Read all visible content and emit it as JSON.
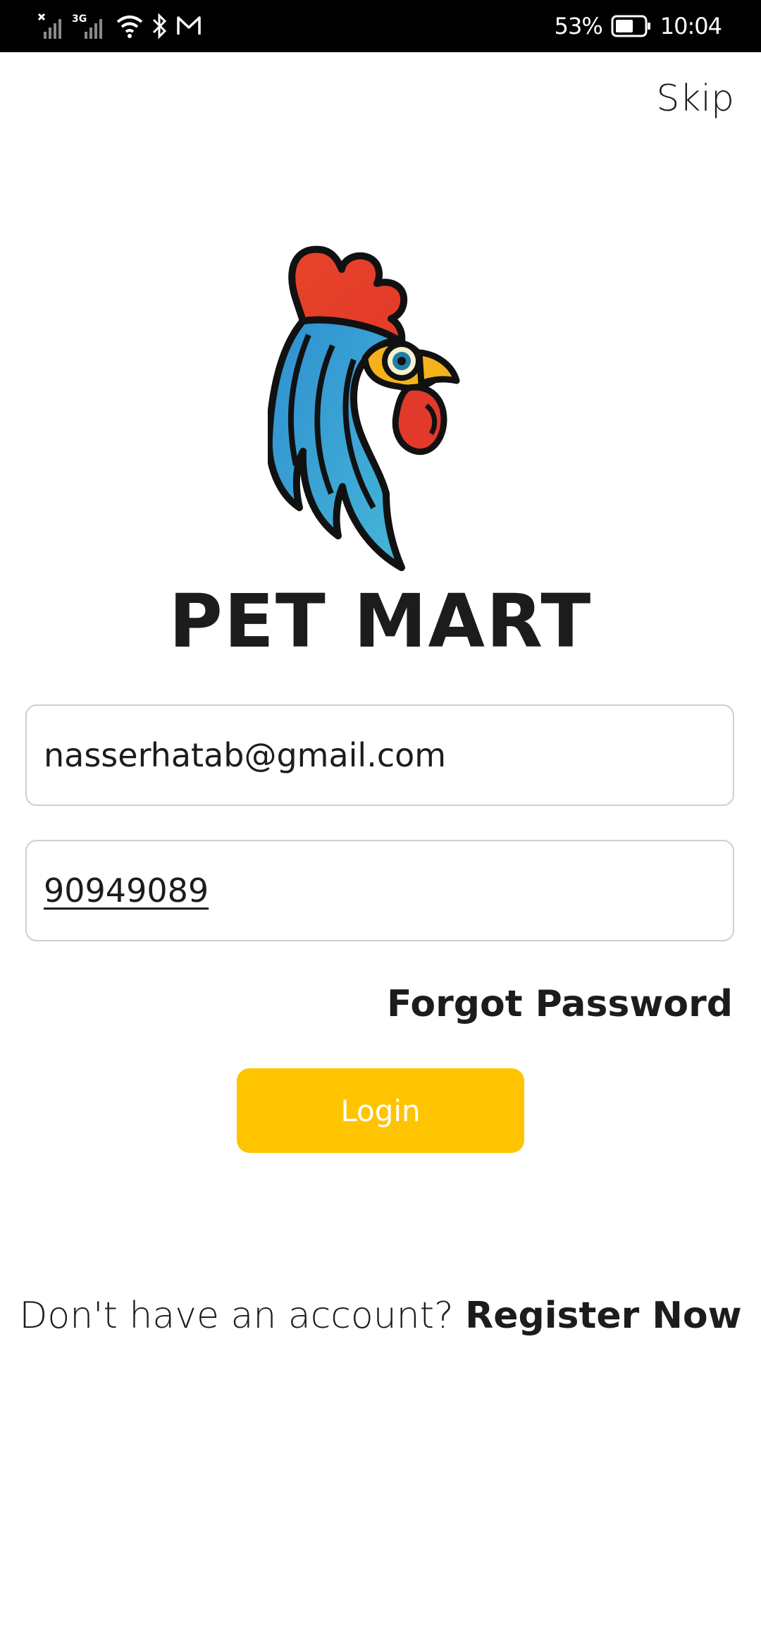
{
  "status_bar": {
    "network_type": "3G",
    "battery_percent": "53%",
    "time": "10:04",
    "icons": [
      "signal-no-service-icon",
      "signal-3g-icon",
      "wifi-icon",
      "bluetooth-icon",
      "gmail-icon",
      "battery-icon"
    ]
  },
  "header": {
    "skip_label": "Skip"
  },
  "brand": {
    "app_name": "PET MART",
    "logo": "rooster-logo",
    "colors": {
      "comb": "#e8442a",
      "feathers": "#2f9fd0",
      "beak": "#f5b21b",
      "outline": "#111111"
    }
  },
  "form": {
    "email_value": "nasserhatab@gmail.com",
    "password_value": "90949089",
    "forgot_password_label": "Forgot Password",
    "login_label": "Login"
  },
  "footer": {
    "register_prompt": "Don't have an account?",
    "register_link": "Register Now"
  },
  "colors": {
    "accent": "#ffc400",
    "text": "#1c1c1e",
    "field_border": "#cfcfcf",
    "status_bar_bg": "#000000"
  }
}
